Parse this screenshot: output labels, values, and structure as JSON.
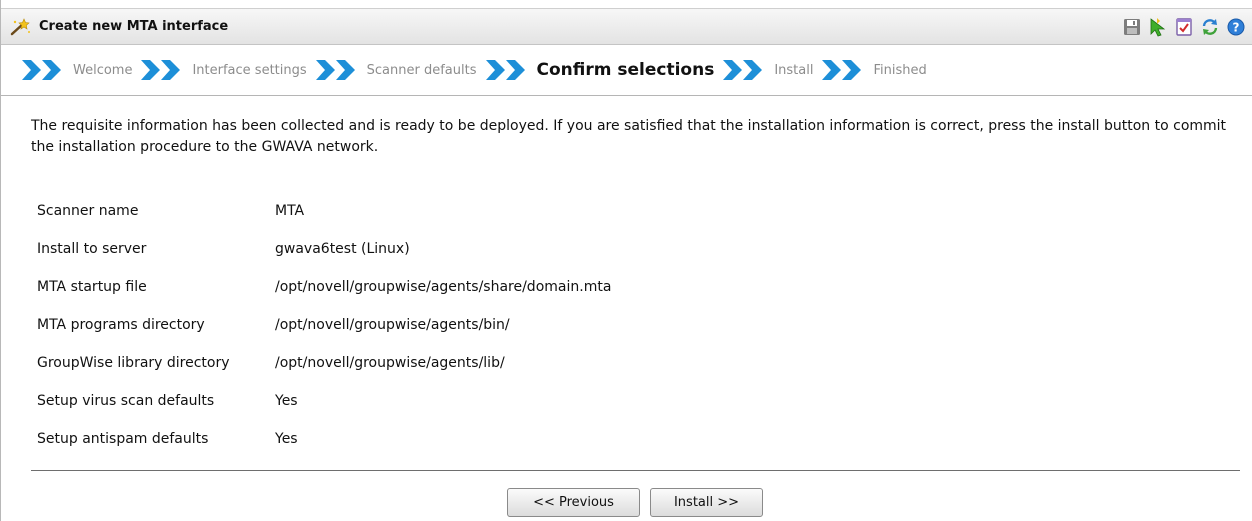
{
  "window": {
    "title": "Create new MTA interface",
    "toolbar_icons": [
      "save-icon",
      "pointer-green-icon",
      "checklist-icon",
      "refresh-icon",
      "help-icon"
    ]
  },
  "steps": [
    {
      "label": "Welcome",
      "active": false
    },
    {
      "label": "Interface settings",
      "active": false
    },
    {
      "label": "Scanner defaults",
      "active": false
    },
    {
      "label": "Confirm selections",
      "active": true
    },
    {
      "label": "Install",
      "active": false
    },
    {
      "label": "Finished",
      "active": false
    }
  ],
  "intro_text": "The requisite information has been collected and is ready to be deployed. If you are satisfied that the installation information is correct, press the install button to commit the installation procedure to the GWAVA network.",
  "details": [
    {
      "label": "Scanner name",
      "value": "MTA"
    },
    {
      "label": "Install to server",
      "value": "gwava6test (Linux)"
    },
    {
      "label": "MTA startup file",
      "value": "/opt/novell/groupwise/agents/share/domain.mta"
    },
    {
      "label": "MTA programs directory",
      "value": "/opt/novell/groupwise/agents/bin/"
    },
    {
      "label": "GroupWise library directory",
      "value": "/opt/novell/groupwise/agents/lib/"
    },
    {
      "label": "Setup virus scan defaults",
      "value": "Yes"
    },
    {
      "label": "Setup antispam defaults",
      "value": "Yes"
    }
  ],
  "buttons": {
    "previous": "<< Previous",
    "install": "Install >>"
  },
  "colors": {
    "chevron": "#1d8fd8",
    "active_step": "#111111",
    "inactive_step": "#8c8c8c"
  }
}
